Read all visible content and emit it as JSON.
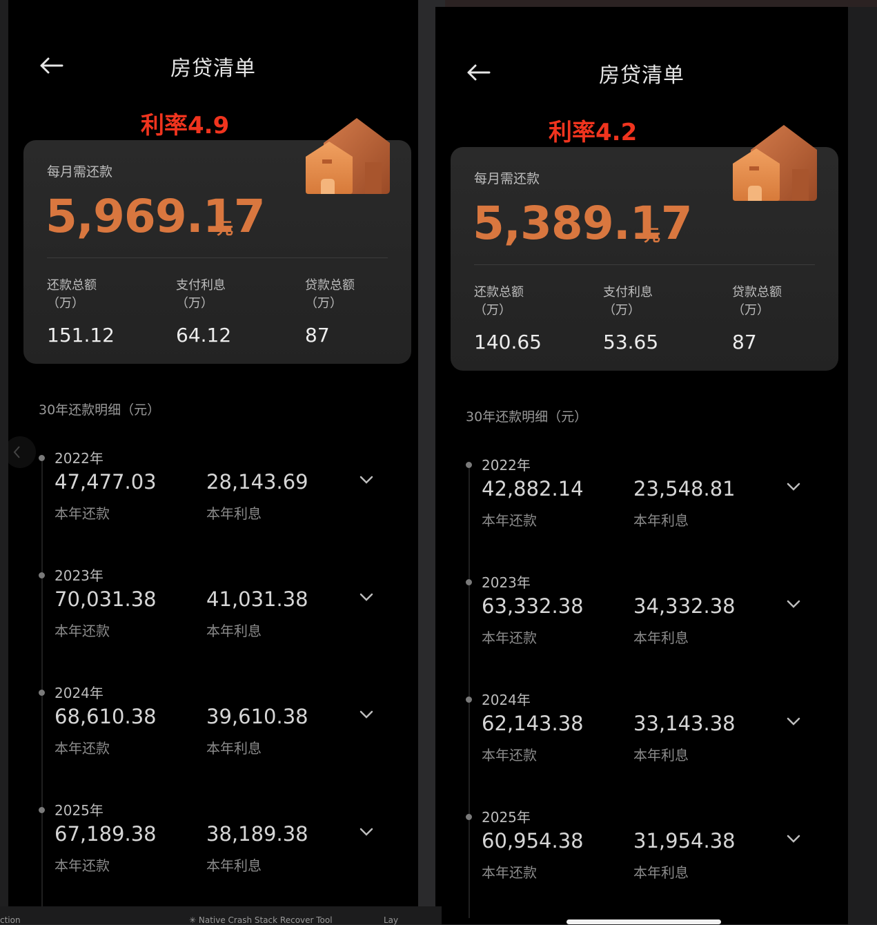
{
  "panels": [
    {
      "title": "房贷清单",
      "rate_label": "利率4.9",
      "monthly_label": "每月需还款",
      "monthly_amount": "5,969.17",
      "monthly_unit": "元",
      "stats": [
        {
          "label": "还款总额\n（万）",
          "value": "151.12"
        },
        {
          "label": "支付利息\n（万）",
          "value": "64.12"
        },
        {
          "label": "贷款总额\n（万）",
          "value": "87"
        }
      ],
      "section_title": "30年还款明细（元）",
      "years": [
        {
          "year": "2022年",
          "payment": "47,477.03",
          "payment_label": "本年还款",
          "interest": "28,143.69",
          "interest_label": "本年利息"
        },
        {
          "year": "2023年",
          "payment": "70,031.38",
          "payment_label": "本年还款",
          "interest": "41,031.38",
          "interest_label": "本年利息"
        },
        {
          "year": "2024年",
          "payment": "68,610.38",
          "payment_label": "本年还款",
          "interest": "39,610.38",
          "interest_label": "本年利息"
        },
        {
          "year": "2025年",
          "payment": "67,189.38",
          "payment_label": "本年还款",
          "interest": "38,189.38",
          "interest_label": "本年利息"
        }
      ]
    },
    {
      "title": "房贷清单",
      "rate_label": "利率4.2",
      "monthly_label": "每月需还款",
      "monthly_amount": "5,389.17",
      "monthly_unit": "元",
      "stats": [
        {
          "label": "还款总额\n（万）",
          "value": "140.65"
        },
        {
          "label": "支付利息\n（万）",
          "value": "53.65"
        },
        {
          "label": "贷款总额\n（万）",
          "value": "87"
        }
      ],
      "section_title": "30年还款明细（元）",
      "years": [
        {
          "year": "2022年",
          "payment": "42,882.14",
          "payment_label": "本年还款",
          "interest": "23,548.81",
          "interest_label": "本年利息"
        },
        {
          "year": "2023年",
          "payment": "63,332.38",
          "payment_label": "本年还款",
          "interest": "34,332.38",
          "interest_label": "本年利息"
        },
        {
          "year": "2024年",
          "payment": "62,143.38",
          "payment_label": "本年还款",
          "interest": "33,143.38",
          "interest_label": "本年利息"
        },
        {
          "year": "2025年",
          "payment": "60,954.38",
          "payment_label": "本年还款",
          "interest": "31,954.38",
          "interest_label": "本年利息"
        }
      ]
    }
  ],
  "taskbar": {
    "left_text": "ction",
    "middle_text": "✳ Native Crash Stack Recover Tool",
    "right_text": "Lay"
  },
  "colors": {
    "accent": "#d9773f",
    "rate_red": "#f0341e",
    "background": "#000000",
    "card": "#262626"
  },
  "icons": {
    "back": "arrow-left-icon",
    "house": "house-icon",
    "expand": "chevron-down-icon"
  }
}
